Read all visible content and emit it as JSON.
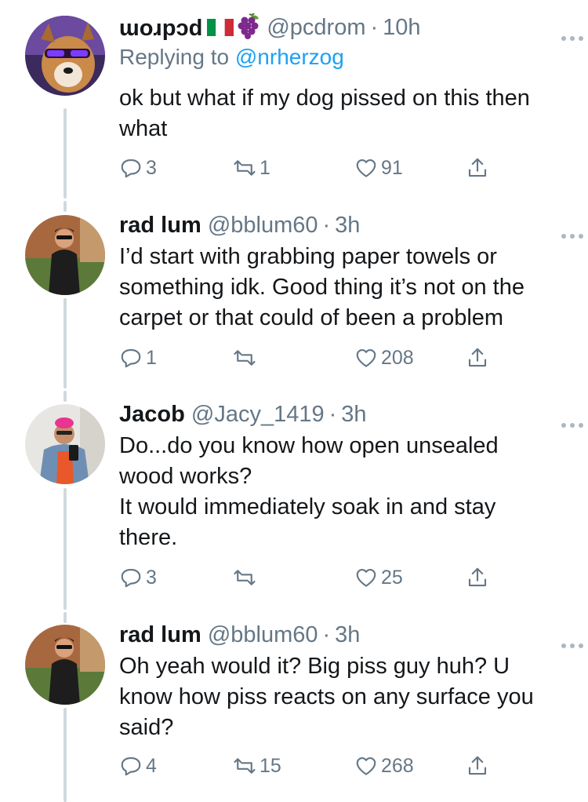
{
  "tweets": [
    {
      "display_name": "pcdrom",
      "handle": "@pcdrom",
      "time": "10h",
      "replying_label": "Replying to",
      "replying_to": "@nrherzog",
      "text": "ok but what if my dog pissed on this then\nwhat",
      "replies": "3",
      "retweets": "1",
      "likes": "91",
      "avatar": "dog-with-sunglasses",
      "flag_icon": "italy-flag-icon",
      "emoji_icon": "grapes-icon"
    },
    {
      "display_name": "rad lum",
      "handle": "@bblum60",
      "time": "3h",
      "text": "I’d start with grabbing paper towels or\nsomething idk. Good thing it’s not on the\ncarpet or that could of been a problem",
      "replies": "1",
      "retweets": "",
      "likes": "208",
      "avatar": "man-in-black-suit"
    },
    {
      "display_name": "Jacob",
      "handle": "@Jacy_1419",
      "time": "3h",
      "text": "Do...do you know how open unsealed\nwood works?\nIt would immediately soak in and stay\nthere.",
      "replies": "3",
      "retweets": "",
      "likes": "25",
      "avatar": "person-pink-hair-denim-jacket"
    },
    {
      "display_name": "rad lum",
      "handle": "@bblum60",
      "time": "3h",
      "text": "Oh yeah would it? Big piss guy huh? U\nknow how piss reacts on any surface you\nsaid?",
      "replies": "4",
      "retweets": "15",
      "likes": "268",
      "avatar": "man-in-black-suit"
    }
  ],
  "colors": {
    "text": "#14171a",
    "secondary": "#657786",
    "link": "#1da1f2",
    "thread_line": "#cfd9de"
  },
  "separator_dot": "·"
}
